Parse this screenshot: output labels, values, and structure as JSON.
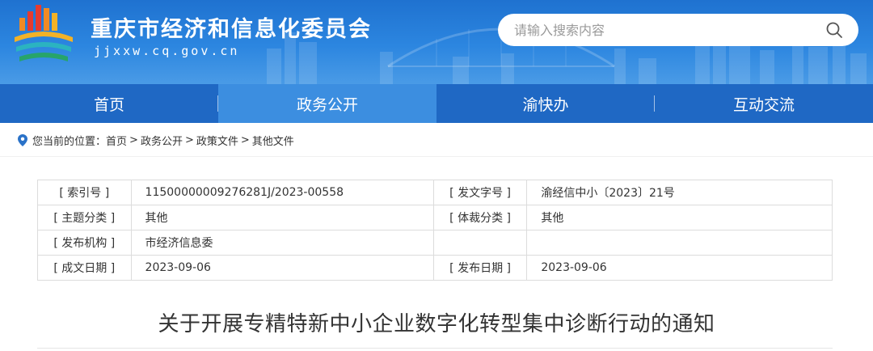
{
  "header": {
    "site_title": "重庆市经济和信息化委员会",
    "site_url": "jjxxw.cq.gov.cn",
    "search_placeholder": "请输入搜索内容"
  },
  "nav": {
    "items": [
      {
        "label": "首页"
      },
      {
        "label": "政务公开"
      },
      {
        "label": "渝快办"
      },
      {
        "label": "互动交流"
      }
    ],
    "active_index": 1
  },
  "breadcrumb": {
    "prefix": "您当前的位置：",
    "items": [
      "首页",
      "政务公开",
      "政策文件",
      "其他文件"
    ],
    "separator": ">"
  },
  "info": {
    "index_label": "[ 索引号 ]",
    "index_value": "11500000009276281J/2023-00558",
    "doc_no_label": "[ 发文字号 ]",
    "doc_no_value": "渝经信中小〔2023〕21号",
    "topic_label": "[ 主题分类 ]",
    "topic_value": "其他",
    "genre_label": "[ 体裁分类 ]",
    "genre_value": "其他",
    "issuer_label": "[ 发布机构 ]",
    "issuer_value": "市经济信息委",
    "written_label": "[ 成文日期 ]",
    "written_value": "2023-09-06",
    "published_label": "[ 发布日期 ]",
    "published_value": "2023-09-06"
  },
  "document": {
    "title": "关于开展专精特新中小企业数字化转型集中诊断行动的通知"
  },
  "colors": {
    "header_blue": "#2c86e0",
    "nav_blue": "#1f68c4",
    "nav_active": "#3c8ee0"
  }
}
